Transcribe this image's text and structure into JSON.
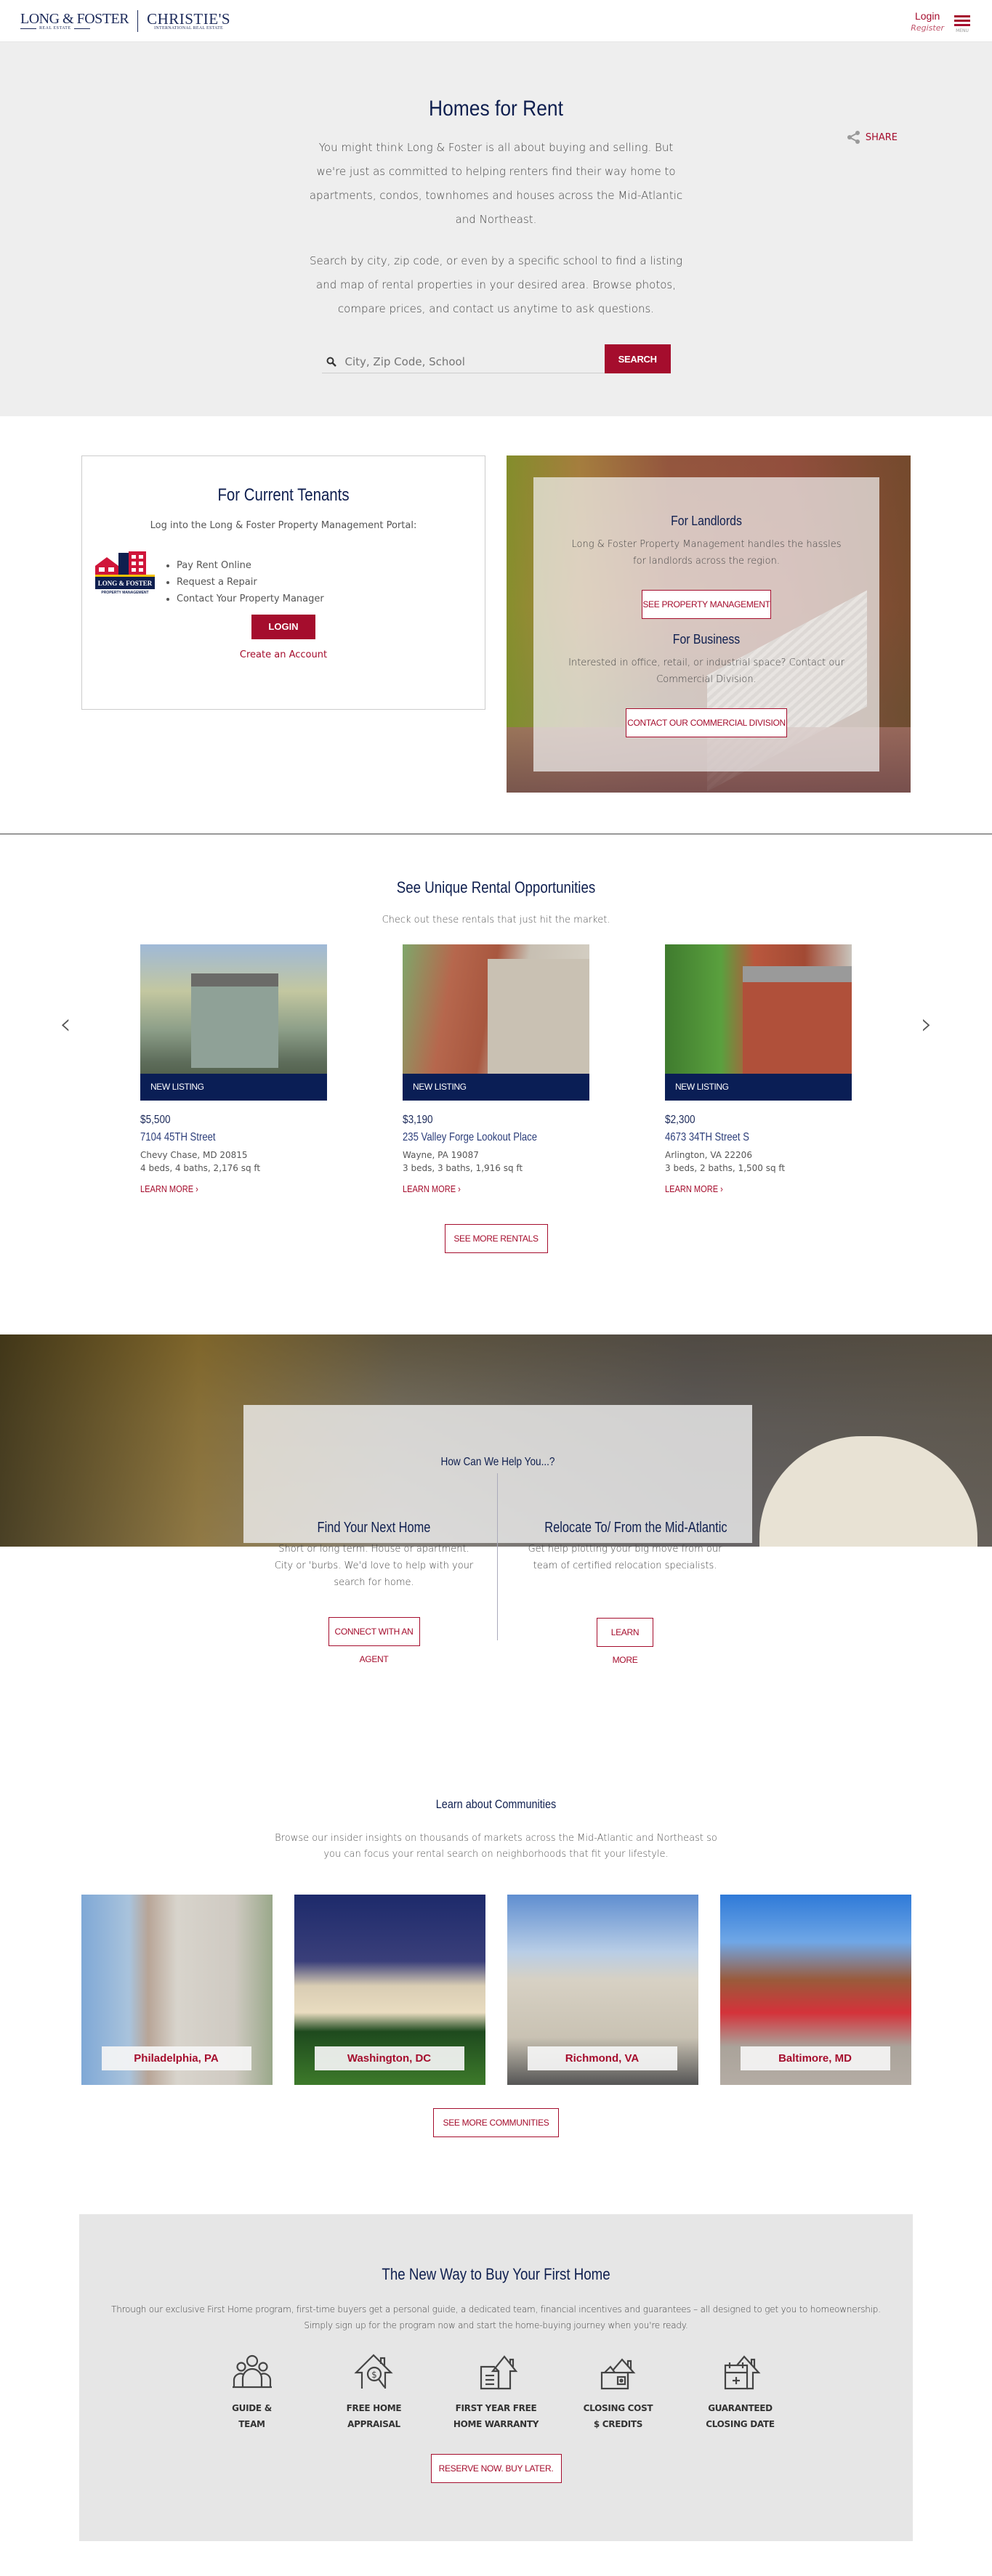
{
  "header": {
    "logo_primary": "LONG & FOSTER",
    "logo_primary_sub": "REAL ESTATE",
    "logo_secondary": "CHRISTIE'S",
    "logo_secondary_sub": "INTERNATIONAL REAL ESTATE",
    "login": "Login",
    "register": "Register",
    "menu": "MENU"
  },
  "hero": {
    "title": "Homes for Rent",
    "share": "SHARE",
    "paragraph1": "You might think Long & Foster is all about buying and selling. But we're just as committed to helping renters find their way home to apartments, condos, townhomes and houses across the Mid-Atlantic and Northeast.",
    "paragraph2": "Search by city, zip code, or even by a specific school to find a listing and map of rental properties in your desired area. Browse photos, compare prices, and contact us anytime to ask questions.",
    "search_placeholder": "City, Zip Code, School",
    "search_value": "",
    "search_button": "SEARCH"
  },
  "tenants": {
    "title": "For Current Tenants",
    "portal_text": "Log into the Long & Foster Property Management Portal:",
    "logo_text": "LONG & FOSTER",
    "logo_sub": "PROPERTY MANAGEMENT",
    "features": [
      "Pay Rent Online",
      "Request a Repair",
      "Contact Your Property Manager"
    ],
    "login_button": "LOGIN",
    "create_account": "Create an Account"
  },
  "landlords": {
    "title": "For Landlords",
    "text": "Long & Foster Property Management handles the hassles for landlords across the region.",
    "button": "SEE PROPERTY MANAGEMENT",
    "business_title": "For Business",
    "business_text": "Interested in office, retail, or industrial space? Contact our Commercial Division.",
    "business_button": "CONTACT OUR COMMERCIAL DIVISION"
  },
  "rentals": {
    "title": "See Unique Rental Opportunities",
    "subtitle": "Check out these rentals that just hit the market.",
    "listings": [
      {
        "tag": "NEW LISTING",
        "price": "$5,500",
        "address": "7104 45TH Street",
        "city": "Chevy Chase, MD 20815",
        "specs": "4 beds, 4 baths, 2,176 sq ft",
        "link": "LEARN MORE"
      },
      {
        "tag": "NEW LISTING",
        "price": "$3,190",
        "address": "235 Valley Forge Lookout Place",
        "city": "Wayne, PA 19087",
        "specs": "3 beds, 3 baths, 1,916 sq ft",
        "link": "LEARN MORE"
      },
      {
        "tag": "NEW LISTING",
        "price": "$2,300",
        "address": "4673 34TH Street S",
        "city": "Arlington, VA 22206",
        "specs": "3 beds, 2 baths, 1,500 sq ft",
        "link": "LEARN MORE"
      }
    ],
    "see_more": "SEE MORE RENTALS"
  },
  "help": {
    "title": "How Can We Help You...?",
    "left_title": "Find Your Next Home",
    "left_text": "Short or long term. House or apartment. City or 'burbs. We'd love to help with your search for home.",
    "left_button": "CONNECT WITH AN AGENT",
    "right_title": "Relocate To/ From the Mid-Atlantic",
    "right_text": "Get help plotting your big move from our team of certified relocation specialists.",
    "right_button": "LEARN MORE"
  },
  "communities": {
    "title": "Learn about Communities",
    "subtitle": "Browse our insider insights on thousands of markets across the Mid-Atlantic and Northeast so you can focus your rental search on neighborhoods that fit your lifestyle.",
    "items": [
      {
        "label": "Philadelphia, PA"
      },
      {
        "label": "Washington, DC"
      },
      {
        "label": "Richmond, VA"
      },
      {
        "label": "Baltimore, MD"
      }
    ],
    "see_more": "SEE MORE COMMUNITIES"
  },
  "first_home": {
    "title": "The New Way to Buy Your First Home",
    "description_line1": "Through our exclusive First Home program, first-time buyers get a personal guide, a dedicated team, financial incentives and guarantees – all designed to get you to homeownership.",
    "description_line2": "Simply sign up for the program now and start the home-buying journey when you're ready.",
    "features": [
      {
        "icon": "team-icon",
        "line1": "GUIDE &",
        "line2": "TEAM"
      },
      {
        "icon": "appraisal-icon",
        "line1": "FREE HOME",
        "line2": "APPRAISAL"
      },
      {
        "icon": "warranty-icon",
        "line1": "FIRST YEAR FREE",
        "line2": "HOME WARRANTY"
      },
      {
        "icon": "credits-icon",
        "line1": "CLOSING COST",
        "line2": "$ CREDITS"
      },
      {
        "icon": "calendar-icon",
        "line1": "GUARANTEED",
        "line2": "CLOSING DATE"
      }
    ],
    "button": "RESERVE NOW. BUY LATER."
  },
  "colors": {
    "brand_red": "#a50d2d",
    "brand_navy": "#0f1f4f",
    "hero_bg": "#eeeeee",
    "first_home_bg": "#e6e6e6",
    "listing_tag_bg": "#0a1e55"
  }
}
